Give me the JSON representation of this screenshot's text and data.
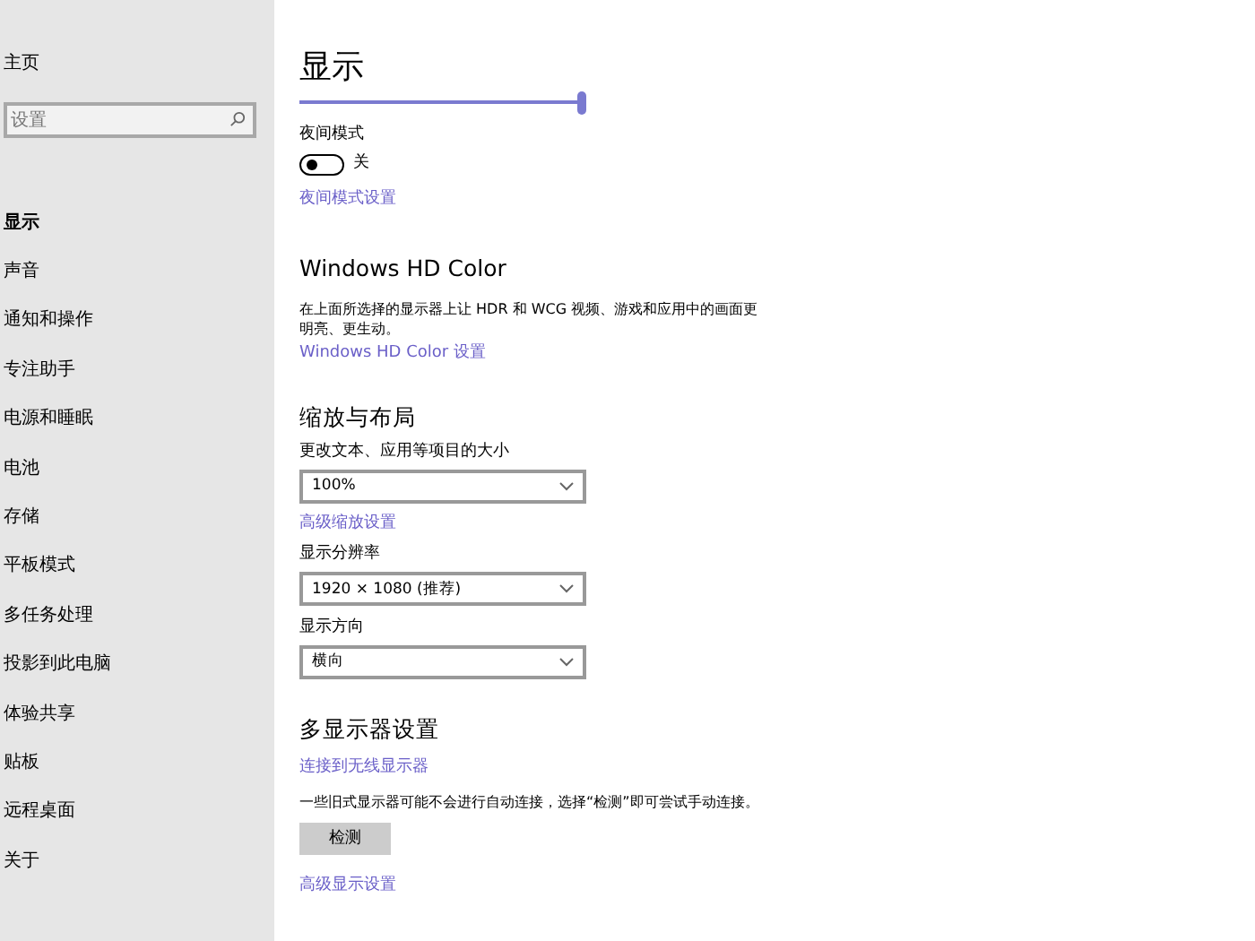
{
  "sidebar": {
    "home": "主页",
    "search": {
      "placeholder": "设置"
    },
    "items": [
      {
        "label": "显示",
        "selected": true
      },
      {
        "label": "声音",
        "selected": false
      },
      {
        "label": "通知和操作",
        "selected": false
      },
      {
        "label": "专注助手",
        "selected": false
      },
      {
        "label": "电源和睡眠",
        "selected": false
      },
      {
        "label": "电池",
        "selected": false
      },
      {
        "label": "存储",
        "selected": false
      },
      {
        "label": "平板模式",
        "selected": false
      },
      {
        "label": "多任务处理",
        "selected": false
      },
      {
        "label": "投影到此电脑",
        "selected": false
      },
      {
        "label": "体验共享",
        "selected": false
      },
      {
        "label": "贴板",
        "selected": false
      },
      {
        "label": "远程桌面",
        "selected": false
      },
      {
        "label": "关于",
        "selected": false
      }
    ]
  },
  "page_title": "显示",
  "brightness": {
    "level": 1.0
  },
  "night_light": {
    "label": "夜间模式",
    "on": false,
    "state_text": "关",
    "link": "夜间模式设置"
  },
  "hd_color": {
    "heading": "Windows HD Color",
    "description": "在上面所选择的显示器上让 HDR 和 WCG 视频、游戏和应用中的画面更明亮、更生动。",
    "link": "Windows HD Color 设置"
  },
  "scale_layout": {
    "heading": "缩放与布局",
    "fields": [
      {
        "kind": "dropdown",
        "label": "更改文本、应用等项目的大小",
        "value": "100%"
      },
      {
        "kind": "link",
        "value": "高级缩放设置"
      },
      {
        "kind": "dropdown",
        "label": "显示分辨率",
        "value": "1920 × 1080 (推荐)"
      },
      {
        "kind": "dropdown",
        "label": "显示方向",
        "value": "横向"
      }
    ]
  },
  "multi_display": {
    "heading": "多显示器设置",
    "link": "连接到无线显示器",
    "description": "一些旧式显示器可能不会进行自动连接，选择“检测”即可尝试手动连接。",
    "button": "检测",
    "advanced_link": "高级显示设置"
  }
}
